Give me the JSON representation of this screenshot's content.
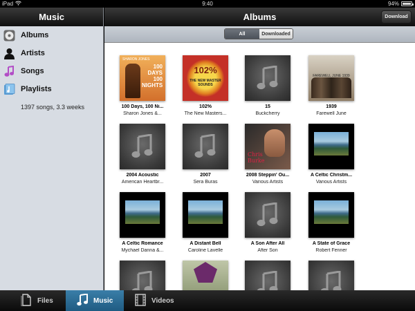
{
  "status": {
    "carrier": "iPad",
    "time": "9:40",
    "battery_text": "94%",
    "battery_level": 0.94
  },
  "sidebar": {
    "title": "Music",
    "items": [
      {
        "label": "Albums",
        "icon": "album-disc-icon"
      },
      {
        "label": "Artists",
        "icon": "person-icon"
      },
      {
        "label": "Songs",
        "icon": "music-note-icon"
      },
      {
        "label": "Playlists",
        "icon": "playlist-icon"
      }
    ],
    "summary": "1397 songs, 3.3 weeks"
  },
  "header": {
    "title": "Albums",
    "download_label": "Download"
  },
  "filter": {
    "all_label": "All",
    "downloaded_label": "Downloaded",
    "selected": "All"
  },
  "albums": [
    {
      "title": "100 Days, 100 Ni...",
      "artist": "Sharon Jones &...",
      "cover": "sharon",
      "cover_text": {
        "header": "SHARON JONES",
        "num": "100 DAYS 100 NIGHTS"
      }
    },
    {
      "title": "102%",
      "artist": "The New Masters...",
      "cover": "pct",
      "cover_text": {
        "big": "102%",
        "sub": "THE NEW MASTER SOUNDS"
      }
    },
    {
      "title": "15",
      "artist": "Buckcherry",
      "cover": "generic"
    },
    {
      "title": "1939",
      "artist": "Farewell June",
      "cover": "band",
      "cover_text": {
        "txt": "FAREWELL JUNE 1939"
      }
    },
    {
      "title": "2004 Acoustic",
      "artist": "American Heartbr...",
      "cover": "generic"
    },
    {
      "title": "2007",
      "artist": "Sera Buras",
      "cover": "generic"
    },
    {
      "title": "2008 Steppin' Ou...",
      "artist": "Various Artists",
      "cover": "chris",
      "cover_text": {
        "name": "Chris Burke"
      }
    },
    {
      "title": "A Celtic Christm...",
      "artist": "Various Artists",
      "cover": "coast"
    },
    {
      "title": "A Celtic Romance",
      "artist": "Mychael Danna &...",
      "cover": "coast"
    },
    {
      "title": "A Distant Bell",
      "artist": "Caroline Lavelle",
      "cover": "coast"
    },
    {
      "title": "A Son After All",
      "artist": "After Son",
      "cover": "generic"
    },
    {
      "title": "A State of Grace",
      "artist": "Robert Fenner",
      "cover": "coast"
    },
    {
      "title": "",
      "artist": "",
      "cover": "generic"
    },
    {
      "title": "",
      "artist": "",
      "cover": "band2"
    },
    {
      "title": "",
      "artist": "",
      "cover": "generic"
    },
    {
      "title": "",
      "artist": "",
      "cover": "generic"
    }
  ],
  "tabs": [
    {
      "label": "Files",
      "icon": "files-icon"
    },
    {
      "label": "Music",
      "icon": "music-note-icon",
      "selected": true
    },
    {
      "label": "Videos",
      "icon": "film-icon"
    }
  ],
  "colors": {
    "accent_tab": "#2d6d96",
    "sidebar_bg": "#d7dce3",
    "header_dark": "#1a1a1a"
  }
}
